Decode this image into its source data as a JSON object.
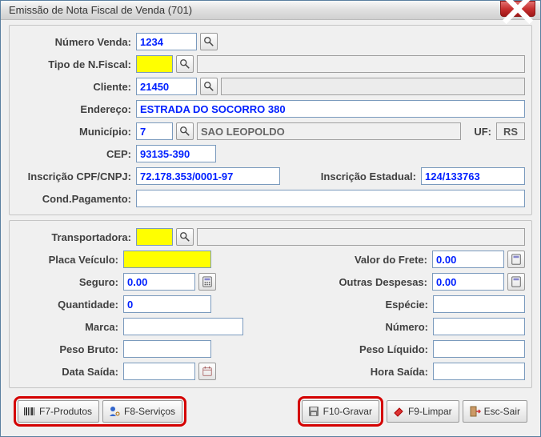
{
  "window": {
    "title": "Emissão de Nota Fiscal de Venda (701)"
  },
  "top": {
    "numero_venda": {
      "label": "Número Venda:",
      "value": "1234"
    },
    "tipo_nfiscal": {
      "label": "Tipo de N.Fiscal:",
      "code": "",
      "desc": ""
    },
    "cliente": {
      "label": "Cliente:",
      "code": "21450",
      "desc": ""
    },
    "endereco": {
      "label": "Endereço:",
      "value": "ESTRADA DO SOCORRO 380"
    },
    "municipio": {
      "label": "Município:",
      "code": "7",
      "desc": "SAO LEOPOLDO",
      "uf_label": "UF:",
      "uf": "RS"
    },
    "cep": {
      "label": "CEP:",
      "value": "93135-390"
    },
    "inscricao_cpf_cnpj": {
      "label": "Inscrição CPF/CNPJ:",
      "value": "72.178.353/0001-97"
    },
    "inscricao_estadual": {
      "label": "Inscrição Estadual:",
      "value": "124/133763"
    },
    "cond_pagamento": {
      "label": "Cond.Pagamento:",
      "value": ""
    }
  },
  "bottom": {
    "transportadora": {
      "label": "Transportadora:",
      "code": "",
      "desc": ""
    },
    "placa_veiculo": {
      "label": "Placa Veículo:",
      "value": ""
    },
    "valor_frete": {
      "label": "Valor do Frete:",
      "value": "0.00"
    },
    "seguro": {
      "label": "Seguro:",
      "value": "0.00"
    },
    "outras_despesas": {
      "label": "Outras Despesas:",
      "value": "0.00"
    },
    "quantidade": {
      "label": "Quantidade:",
      "value": "0"
    },
    "especie": {
      "label": "Espécie:",
      "value": ""
    },
    "marca": {
      "label": "Marca:",
      "value": ""
    },
    "numero": {
      "label": "Número:",
      "value": ""
    },
    "peso_bruto": {
      "label": "Peso Bruto:",
      "value": ""
    },
    "peso_liquido": {
      "label": "Peso Líquido:",
      "value": ""
    },
    "data_saida": {
      "label": "Data Saída:",
      "value": ""
    },
    "hora_saida": {
      "label": "Hora Saída:",
      "value": ""
    }
  },
  "toolbar": {
    "produtos": "F7-Produtos",
    "servicos": "F8-Serviços",
    "gravar": "F10-Gravar",
    "limpar": "F9-Limpar",
    "sair": "Esc-Sair"
  }
}
